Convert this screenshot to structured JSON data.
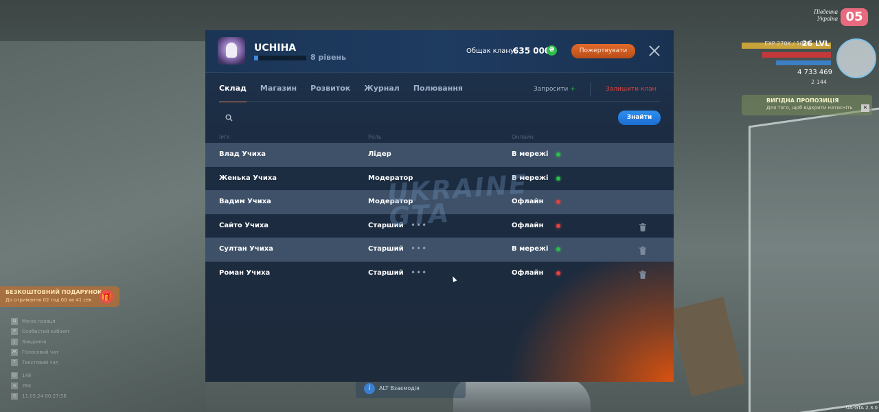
{
  "hud": {
    "region": "Південна\nУкраїна",
    "server_number": "05",
    "exp": "EXP 270K / 106K",
    "level": "26 LVL",
    "money": "4 733 469",
    "sub": "2 144",
    "offer_title": "ВИГІДНА ПРОПОЗИЦІЯ",
    "offer_sub": "Для того, щоб відкрити натисніть",
    "offer_key": "R",
    "gift_title": "БЕЗКОШТОВНИЙ ПОДАРУНОК",
    "gift_sub": "До отримання 02 год 00 хв 41 сек",
    "left_items": [
      {
        "key": "Q",
        "label": "Меню гравця"
      },
      {
        "key": "P",
        "label": "Особистий кабінет"
      },
      {
        "key": "J",
        "label": "Завдання"
      },
      {
        "key": "Ж",
        "label": "Голосовий чат"
      },
      {
        "key": "T",
        "label": "Текстовий чат"
      }
    ],
    "stats": [
      "148",
      "284",
      "11.05.24 00:27:56"
    ],
    "alt_hint": "ALT Взаємодія",
    "version": "UA-GTA 2.3.0"
  },
  "clan": {
    "name": "UCHIHA",
    "level_text": "8 рівень",
    "level_progress": 0.08,
    "money_label": "Общак клану:",
    "money_value": "635 000",
    "coin_icon": "₴",
    "donate_label": "Пожертвувати"
  },
  "tabs": [
    {
      "label": "Склад",
      "active": true
    },
    {
      "label": "Магазин",
      "active": false
    },
    {
      "label": "Розвиток",
      "active": false
    },
    {
      "label": "Журнал",
      "active": false
    },
    {
      "label": "Полювання",
      "active": false
    }
  ],
  "actions": {
    "invite_label": "Запросити",
    "invite_plus": "+",
    "leave_label": "Залишити клан"
  },
  "search": {
    "placeholder": "",
    "button_label": "Знайти"
  },
  "columns": {
    "name": "Ім'я",
    "role": "Роль",
    "online": "Онлайн"
  },
  "members": [
    {
      "name": "Влад Учиха",
      "role": "Лідер",
      "status": "В мережі",
      "online": true,
      "menu": false,
      "trash": false
    },
    {
      "name": "Женька Учиха",
      "role": "Модератор",
      "status": "В мережі",
      "online": true,
      "menu": false,
      "trash": false
    },
    {
      "name": "Вадим Учиха",
      "role": "Модератор",
      "status": "Офлайн",
      "online": false,
      "menu": false,
      "trash": false
    },
    {
      "name": "Сайто Учиха",
      "role": "Старший",
      "status": "Офлайн",
      "online": false,
      "menu": true,
      "trash": true
    },
    {
      "name": "Султан Учиха",
      "role": "Старший",
      "status": "В мережі",
      "online": true,
      "menu": true,
      "trash": true
    },
    {
      "name": "Роман Учиха",
      "role": "Старший",
      "status": "Офлайн",
      "online": false,
      "menu": true,
      "trash": true
    }
  ],
  "colors": {
    "online": "#2dbd4a",
    "offline": "#e2423d",
    "accent": "#e06a2a"
  },
  "watermark": "UKRAINE\nGTA"
}
